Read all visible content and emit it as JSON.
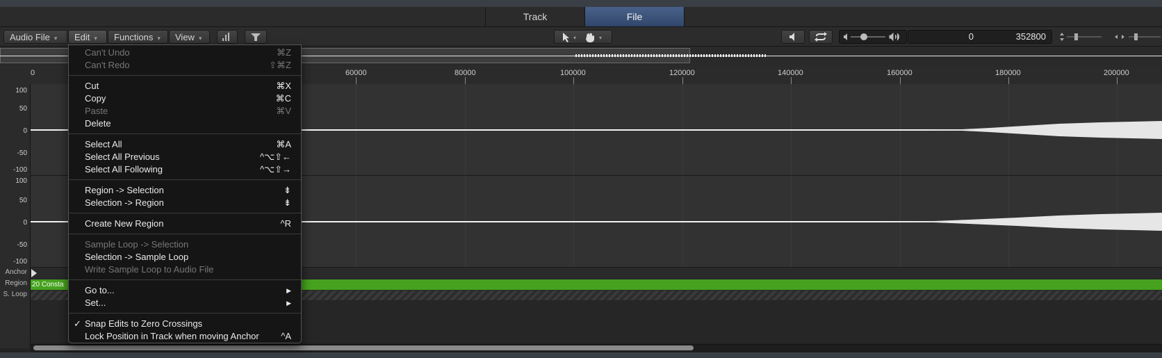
{
  "tabs": [
    {
      "label": "Track",
      "active": false
    },
    {
      "label": "File",
      "active": true
    }
  ],
  "toolbar": {
    "audio_file": "Audio File",
    "edit": "Edit",
    "functions": "Functions",
    "view": "View",
    "dropdown_glyph": "▾",
    "position_start": "0",
    "position_end": "352800"
  },
  "ruler": {
    "ticks": [
      "0",
      "60000",
      "80000",
      "100000",
      "120000",
      "140000",
      "160000",
      "180000",
      "200000"
    ]
  },
  "channel_scale": [
    "100",
    "50",
    "0",
    "-50",
    "-100"
  ],
  "lanes": {
    "anchor": "Anchor",
    "region": "Region",
    "sloop": "S. Loop"
  },
  "region_name": "20 Consta",
  "menu": {
    "items": [
      {
        "label": "Can't Undo",
        "shortcut": "⌘Z",
        "disabled": true
      },
      {
        "label": "Can't Redo",
        "shortcut": "⇧⌘Z",
        "disabled": true
      },
      {
        "label": "Cut",
        "shortcut": "⌘X",
        "disabled": false
      },
      {
        "label": "Copy",
        "shortcut": "⌘C",
        "disabled": false
      },
      {
        "label": "Paste",
        "shortcut": "⌘V",
        "disabled": true
      },
      {
        "label": "Delete",
        "shortcut": "",
        "disabled": false
      },
      {
        "label": "Select All",
        "shortcut": "⌘A",
        "disabled": false
      },
      {
        "label": "Select All Previous",
        "shortcut": "^⌥⇧←",
        "disabled": false
      },
      {
        "label": "Select All Following",
        "shortcut": "^⌥⇧→",
        "disabled": false
      },
      {
        "label": "Region -> Selection",
        "shortcut": "⇟",
        "disabled": false
      },
      {
        "label": "Selection -> Region",
        "shortcut": "⇟",
        "disabled": false
      },
      {
        "label": "Create New Region",
        "shortcut": "^R",
        "disabled": false
      },
      {
        "label": "Sample Loop -> Selection",
        "shortcut": "",
        "disabled": true
      },
      {
        "label": "Selection -> Sample Loop",
        "shortcut": "",
        "disabled": false
      },
      {
        "label": "Write Sample Loop to Audio File",
        "shortcut": "",
        "disabled": true
      },
      {
        "label": "Go to...",
        "shortcut": "▶",
        "disabled": false
      },
      {
        "label": "Set...",
        "shortcut": "▶",
        "disabled": false
      },
      {
        "label": "Snap Edits to Zero Crossings",
        "shortcut": "",
        "disabled": false,
        "checked": true
      },
      {
        "label": "Lock Position in Track when moving Anchor",
        "shortcut": "^A",
        "disabled": false
      }
    ],
    "check_glyph": "✓"
  },
  "icons": [
    "pointer-tool-icon",
    "hand-tool-icon",
    "speaker-icon",
    "cycle-icon",
    "volume-slider-icon",
    "zoom-stepper-icon"
  ]
}
